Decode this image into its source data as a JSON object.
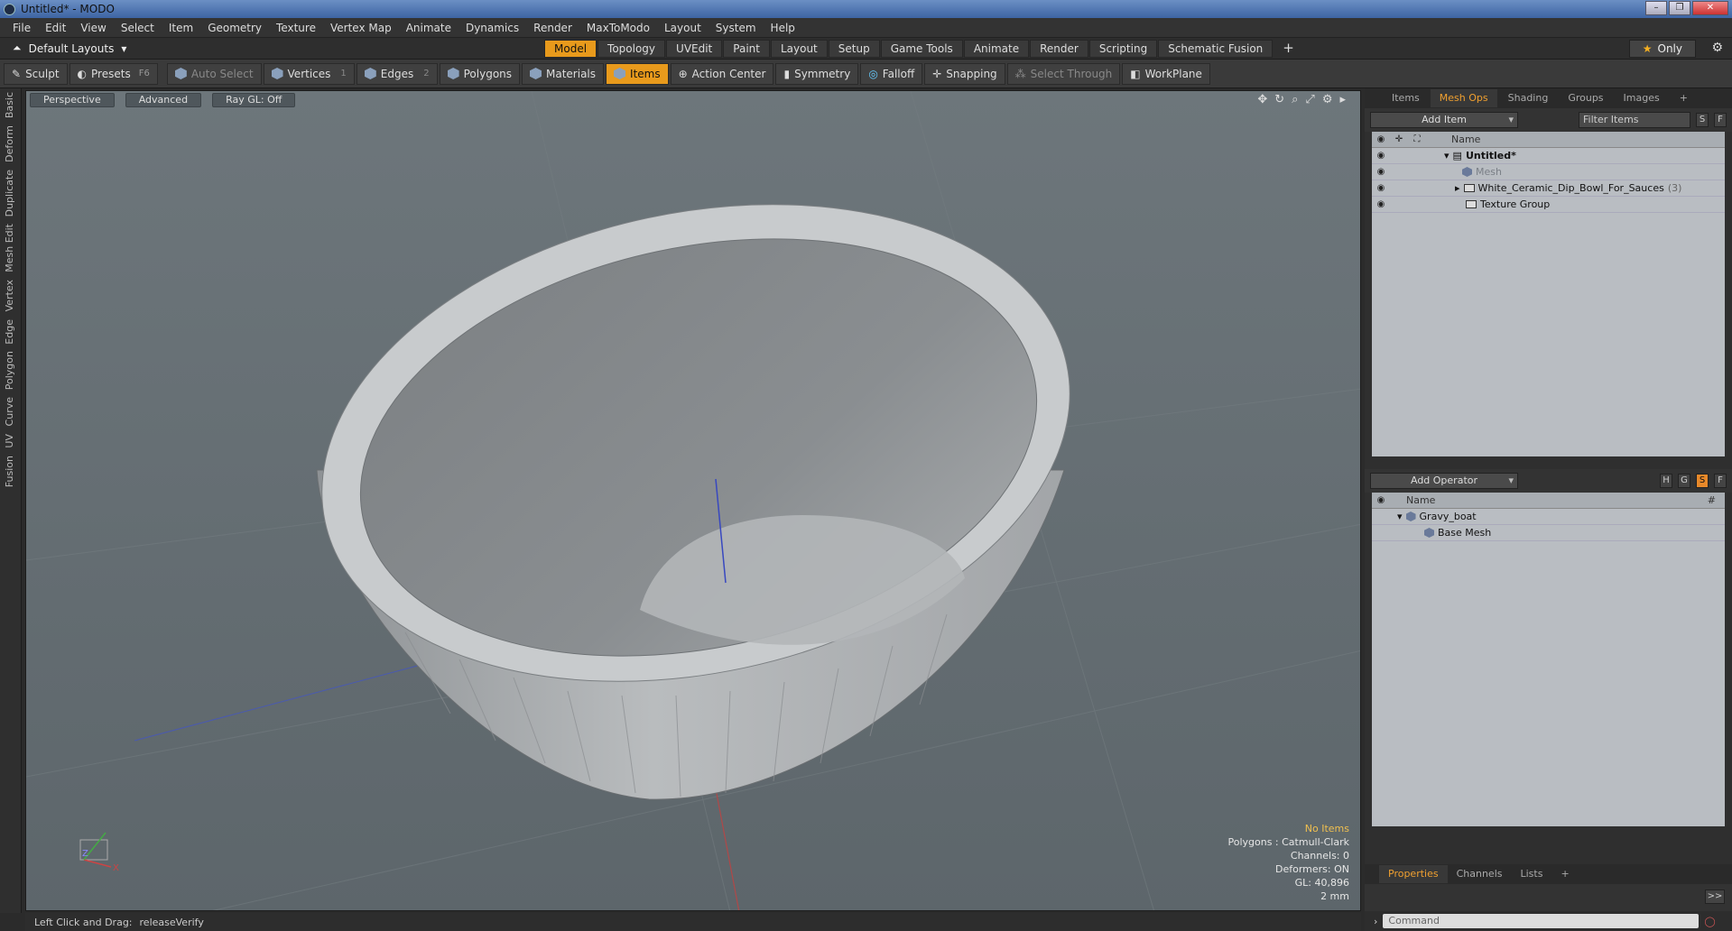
{
  "window": {
    "title": "Untitled* - MODO",
    "buttons": [
      "–",
      "❐",
      "✕"
    ]
  },
  "menu": [
    "File",
    "Edit",
    "View",
    "Select",
    "Item",
    "Geometry",
    "Texture",
    "Vertex Map",
    "Animate",
    "Dynamics",
    "Render",
    "MaxToModo",
    "Layout",
    "System",
    "Help"
  ],
  "layout_selector": "Default Layouts",
  "mode_tabs": [
    "Model",
    "Topology",
    "UVEdit",
    "Paint",
    "Layout",
    "Setup",
    "Game Tools",
    "Animate",
    "Render",
    "Scripting",
    "Schematic Fusion"
  ],
  "active_mode": "Model",
  "only_label": "Only",
  "toolbar": {
    "sculpt": "Sculpt",
    "presets": "Presets",
    "presets_key": "F6",
    "auto_select": "Auto Select",
    "vertices": "Vertices",
    "vertices_num": "1",
    "edges": "Edges",
    "edges_num": "2",
    "polygons": "Polygons",
    "materials": "Materials",
    "items": "Items",
    "action_center": "Action Center",
    "symmetry": "Symmetry",
    "falloff": "Falloff",
    "snapping": "Snapping",
    "select_through": "Select Through",
    "workplane": "WorkPlane"
  },
  "left_tabs": [
    "Basic",
    "Deform",
    "Duplicate",
    "Mesh Edit",
    "Vertex",
    "Edge",
    "Polygon",
    "Curve",
    "UV",
    "Fusion"
  ],
  "viewport": {
    "view": "Perspective",
    "shading": "Advanced",
    "raygl": "Ray GL: Off",
    "info": {
      "selection": "No Items",
      "polygons": "Polygons : Catmull-Clark",
      "channels": "Channels: 0",
      "deformers": "Deformers: ON",
      "gl": "GL: 40,896",
      "scale": "2 mm"
    }
  },
  "status": {
    "hint": "Left Click and Drag:",
    "action": "releaseVerify"
  },
  "items_panel": {
    "tabs": [
      "Items",
      "Mesh Ops",
      "Shading",
      "Groups",
      "Images",
      "+"
    ],
    "active_tab": "Mesh Ops",
    "add_item": "Add Item",
    "filter_placeholder": "Filter Items",
    "btn_s": "S",
    "btn_f": "F",
    "col_name": "Name",
    "rows": [
      {
        "name": "Untitled*"
      },
      {
        "name": "Mesh"
      },
      {
        "name": "White_Ceramic_Dip_Bowl_For_Sauces",
        "count": "(3)"
      },
      {
        "name": "Texture Group"
      }
    ]
  },
  "operator_panel": {
    "add_operator": "Add Operator",
    "btns": [
      "H",
      "G",
      "S",
      "F"
    ],
    "col_name": "Name",
    "col_hash": "#",
    "rows": [
      {
        "name": "Gravy_boat"
      },
      {
        "name": "Base Mesh"
      }
    ]
  },
  "bottom_tabs": [
    "Properties",
    "Channels",
    "Lists",
    "+"
  ],
  "active_bottom_tab": "Properties",
  "command_placeholder": "Command",
  "expand_label": ">>"
}
